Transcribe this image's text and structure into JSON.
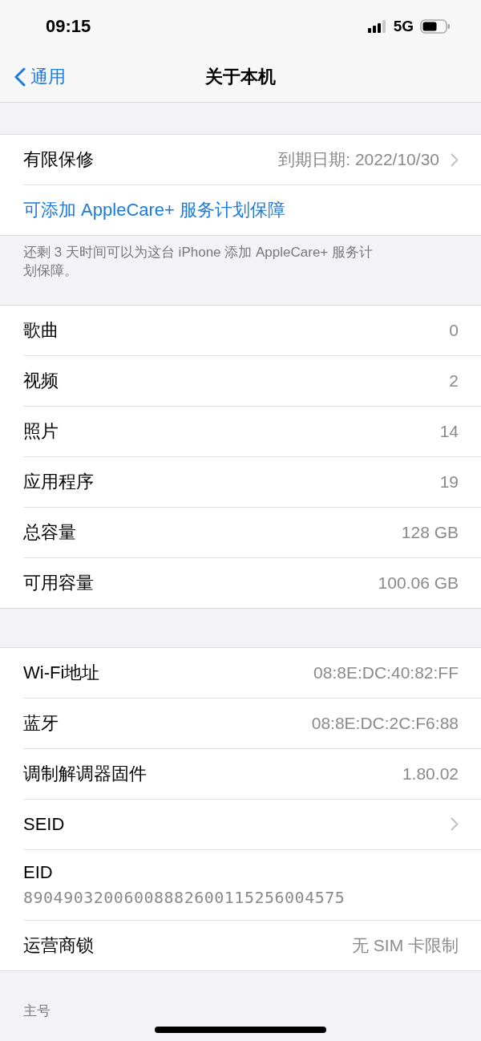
{
  "status_bar": {
    "time": "09:15",
    "network": "5G"
  },
  "nav": {
    "back": "通用",
    "title": "关于本机"
  },
  "sections": [
    {
      "rows": [
        {
          "kind": "disclosure",
          "label": "有限保修",
          "value": "到期日期: 2022/10/30"
        },
        {
          "kind": "link",
          "label": "可添加 AppleCare+ 服务计划保障"
        }
      ],
      "footer": "还剩 3 天时间可以为这台 iPhone 添加 AppleCare+ 服务计划保障。"
    },
    {
      "rows": [
        {
          "kind": "value",
          "label": "歌曲",
          "value": "0"
        },
        {
          "kind": "value",
          "label": "视频",
          "value": "2"
        },
        {
          "kind": "value",
          "label": "照片",
          "value": "14"
        },
        {
          "kind": "value",
          "label": "应用程序",
          "value": "19"
        },
        {
          "kind": "value",
          "label": "总容量",
          "value": "128 GB"
        },
        {
          "kind": "value",
          "label": "可用容量",
          "value": "100.06 GB"
        }
      ]
    },
    {
      "rows": [
        {
          "kind": "value",
          "label": "Wi-Fi地址",
          "value": "08:8E:DC:40:82:FF"
        },
        {
          "kind": "value",
          "label": "蓝牙",
          "value": "08:8E:DC:2C:F6:88"
        },
        {
          "kind": "value",
          "label": "调制解调器固件",
          "value": "1.80.02"
        },
        {
          "kind": "disclosure",
          "label": "SEID"
        },
        {
          "kind": "stacked",
          "label": "EID",
          "value": "89049032006008882600115256004575"
        },
        {
          "kind": "value",
          "label": "运营商锁",
          "value": "无 SIM 卡限制"
        }
      ]
    },
    {
      "header": "主号"
    }
  ]
}
